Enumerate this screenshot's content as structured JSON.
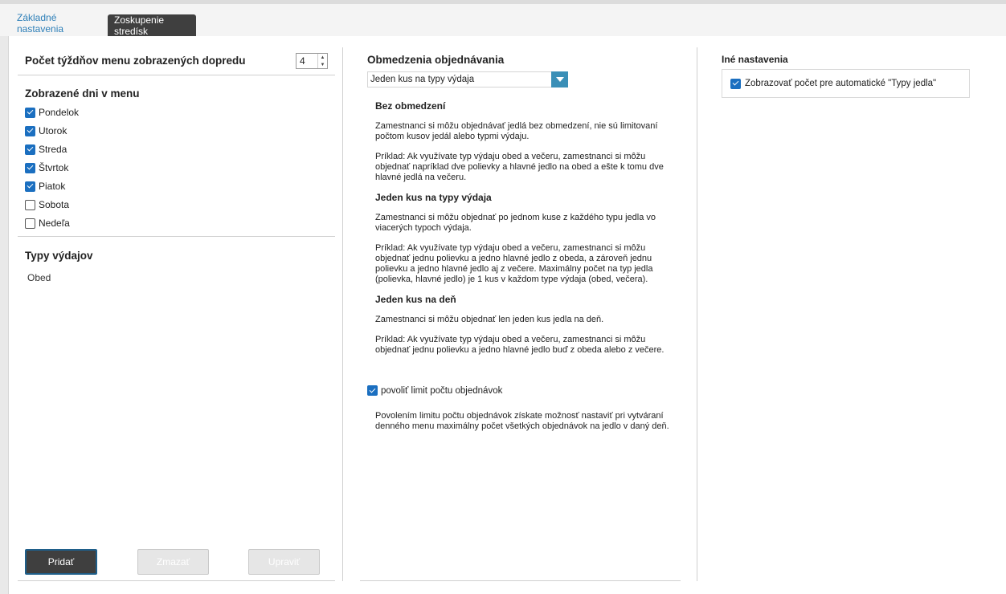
{
  "tabs": [
    {
      "label": "Základné nastavenia"
    },
    {
      "label": "Zoskupenie stredísk"
    }
  ],
  "left": {
    "weeks_label": "Počet týždňov menu zobrazených dopredu",
    "weeks_value": "4",
    "days_title": "Zobrazené dni v menu",
    "days": [
      {
        "label": "Pondelok",
        "checked": true
      },
      {
        "label": "Utorok",
        "checked": true
      },
      {
        "label": "Streda",
        "checked": true
      },
      {
        "label": "Štvrtok",
        "checked": true
      },
      {
        "label": "Piatok",
        "checked": true
      },
      {
        "label": "Sobota",
        "checked": false
      },
      {
        "label": "Nedeľa",
        "checked": false
      }
    ],
    "types_title": "Typy výdajov",
    "types": [
      "Obed"
    ],
    "buttons": {
      "add": "Pridať",
      "delete": "Zmazať",
      "edit": "Upraviť"
    }
  },
  "middle": {
    "title": "Obmedzenia objednávania",
    "select_value": "Jeden kus na typy výdaja",
    "h1": "Bez obmedzení",
    "p1": "Zamestnanci si môžu objednávať jedlá bez obmedzení, nie sú limitovaní počtom kusov jedál alebo typmi výdaju.",
    "p2": "Príklad: Ak využívate typ výdaju obed a večeru, zamestnanci si môžu objednať napríklad dve polievky a hlavné jedlo na obed a ešte k tomu dve hlavné jedlá na večeru.",
    "h2": "Jeden kus na typy výdaja",
    "p3": "Zamestnanci si môžu objednať po jednom kuse z každého typu jedla vo viacerých typoch výdaja.",
    "p4": "Príklad: Ak využívate typ výdaju obed a večeru, zamestnanci si môžu objednať jednu polievku a jedno hlavné jedlo z obeda, a zároveň jednu polievku a jedno hlavné jedlo aj z večere. Maximálny počet na typ jedla (polievka, hlavné jedlo) je 1 kus v každom type výdaja (obed, večera).",
    "h3": "Jeden kus na deň",
    "p5": "Zamestnanci si môžu objednať len jeden kus jedla na deň.",
    "p6": "Príklad: Ak využívate typ výdaju obed a večeru, zamestnanci si môžu objednať jednu polievku a jedno hlavné jedlo buď z obeda alebo z večere.",
    "limit_label": "povoliť limit počtu objednávok",
    "limit_note": "Povolením limitu počtu objednávok získate možnosť nastaviť pri vytváraní denného menu maximálny počet všetkých objednávok na jedlo v daný deň."
  },
  "right": {
    "title": "Iné nastavenia",
    "option_label": "Zobrazovať počet pre automatické \"Typy jedla\""
  }
}
